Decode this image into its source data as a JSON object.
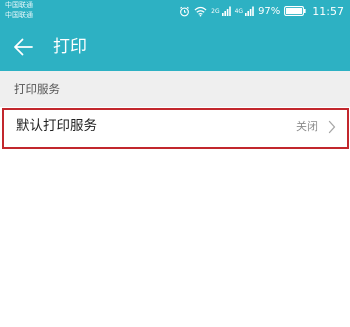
{
  "status_bar": {
    "carrier_line_1": "中国联通",
    "carrier_line_2": "中国联通",
    "sim1_tag": "2G",
    "sim2_tag": "4G",
    "battery_percent": "97%",
    "time": "11:57",
    "icons": [
      "alarm-icon",
      "wifi-icon",
      "signal-icon",
      "signal-icon",
      "battery-icon"
    ]
  },
  "toolbar": {
    "back_icon": "arrow-left-icon",
    "title": "打印"
  },
  "section": {
    "header": "打印服务"
  },
  "rows": [
    {
      "label": "默认打印服务",
      "value": "关闭",
      "icon": "chevron-right-icon"
    }
  ],
  "colors": {
    "app_bar": "#2db1c3",
    "section_bg": "#efefef",
    "highlight": "#c2272d"
  }
}
